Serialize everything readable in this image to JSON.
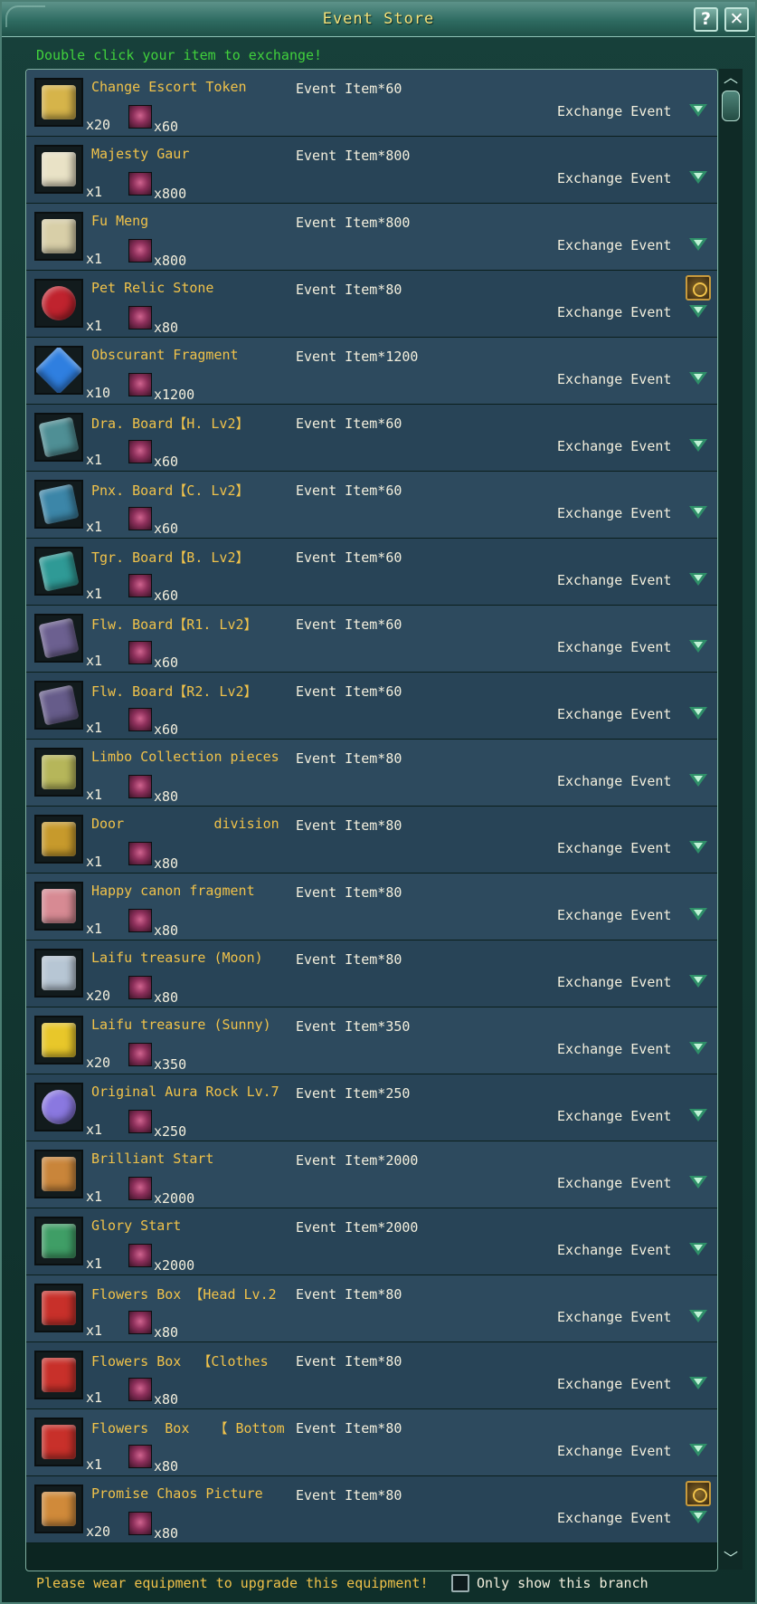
{
  "window": {
    "title": "Event Store",
    "help_label": "?",
    "close_label": "✕"
  },
  "hint": "Double click your item to exchange!",
  "exchange_label": "Exchange Event",
  "items": [
    {
      "name": "Change Escort Token",
      "price": "Event Item*60",
      "qty": "x20",
      "cost": "x60",
      "icon": "token-icon",
      "color": "#d6b44a",
      "badge": false
    },
    {
      "name": "Majesty Gaur",
      "price": "Event Item*800",
      "qty": "x1",
      "cost": "x800",
      "icon": "gaur-mount-icon",
      "color": "#e9e2c6",
      "badge": false
    },
    {
      "name": "Fu Meng",
      "price": "Event Item*800",
      "qty": "x1",
      "cost": "x800",
      "icon": "fu-meng-mount-icon",
      "color": "#d8cfa8",
      "badge": false
    },
    {
      "name": "Pet Relic Stone",
      "price": "Event Item*80",
      "qty": "x1",
      "cost": "x80",
      "icon": "relic-stone-icon",
      "color": "#c0232e",
      "badge": true
    },
    {
      "name": "Obscurant Fragment",
      "price": "Event Item*1200",
      "qty": "x10",
      "cost": "x1200",
      "icon": "crystal-icon",
      "color": "#2f7fe0",
      "badge": false
    },
    {
      "name": "Dra. Board【H. Lv2】",
      "price": "Event Item*60",
      "qty": "x1",
      "cost": "x60",
      "icon": "board-icon",
      "color": "#4f8f95",
      "badge": false
    },
    {
      "name": "Pnx. Board【C. Lv2】",
      "price": "Event Item*60",
      "qty": "x1",
      "cost": "x60",
      "icon": "board-icon",
      "color": "#3c86a8",
      "badge": false
    },
    {
      "name": "Tgr. Board【B. Lv2】",
      "price": "Event Item*60",
      "qty": "x1",
      "cost": "x60",
      "icon": "board-icon",
      "color": "#2f9a96",
      "badge": false
    },
    {
      "name": "Flw. Board【R1. Lv2】",
      "price": "Event Item*60",
      "qty": "x1",
      "cost": "x60",
      "icon": "board-icon",
      "color": "#6c6090",
      "badge": false
    },
    {
      "name": "Flw. Board【R2. Lv2】",
      "price": "Event Item*60",
      "qty": "x1",
      "cost": "x60",
      "icon": "board-icon",
      "color": "#665c8a",
      "badge": false
    },
    {
      "name": "Limbo Collection pieces",
      "price": "Event Item*80",
      "qty": "x1",
      "cost": "x80",
      "icon": "leaf-pieces-icon",
      "color": "#b6b65a",
      "badge": false
    },
    {
      "name": "Door           division",
      "price": "Event Item*80",
      "qty": "x1",
      "cost": "x80",
      "icon": "door-scroll-icon",
      "color": "#c79a2c",
      "badge": false
    },
    {
      "name": "Happy canon fragment",
      "price": "Event Item*80",
      "qty": "x1",
      "cost": "x80",
      "icon": "canon-fragment-icon",
      "color": "#d78a93",
      "badge": false
    },
    {
      "name": "Laifu treasure (Moon)",
      "price": "Event Item*80",
      "qty": "x20",
      "cost": "x80",
      "icon": "moon-treasure-icon",
      "color": "#b7c6d4",
      "badge": false
    },
    {
      "name": "Laifu treasure (Sunny)",
      "price": "Event Item*350",
      "qty": "x20",
      "cost": "x350",
      "icon": "sun-treasure-icon",
      "color": "#e8c72a",
      "badge": false
    },
    {
      "name": "Original Aura Rock Lv.7",
      "price": "Event Item*250",
      "qty": "x1",
      "cost": "x250",
      "icon": "aura-rock-icon",
      "color": "#8a78e0",
      "badge": false
    },
    {
      "name": "Brilliant Start",
      "price": "Event Item*2000",
      "qty": "x1",
      "cost": "x2000",
      "icon": "brilliant-ring-icon",
      "color": "#c9853a",
      "badge": false
    },
    {
      "name": "Glory Start",
      "price": "Event Item*2000",
      "qty": "x1",
      "cost": "x2000",
      "icon": "glory-ring-icon",
      "color": "#3f9e66",
      "badge": false
    },
    {
      "name": "Flowers Box 【Head Lv.2",
      "price": "Event Item*80",
      "qty": "x1",
      "cost": "x80",
      "icon": "gift-box-icon",
      "color": "#c8302a",
      "badge": false
    },
    {
      "name": "Flowers Box  【Clothes",
      "price": "Event Item*80",
      "qty": "x1",
      "cost": "x80",
      "icon": "gift-box-icon",
      "color": "#c8302a",
      "badge": false
    },
    {
      "name": "Flowers  Box   【 Bottom",
      "price": "Event Item*80",
      "qty": "x1",
      "cost": "x80",
      "icon": "gift-box-icon",
      "color": "#c8302a",
      "badge": false
    },
    {
      "name": "Promise Chaos Picture",
      "price": "Event Item*80",
      "qty": "x20",
      "cost": "x80",
      "icon": "chaos-picture-icon",
      "color": "#d08a3a",
      "badge": true
    }
  ],
  "scroll": {
    "up": "︿",
    "down": "﹀"
  },
  "footer": {
    "message": "Please wear equipment to upgrade this equipment!",
    "only_branch_label": "Only show this branch"
  }
}
